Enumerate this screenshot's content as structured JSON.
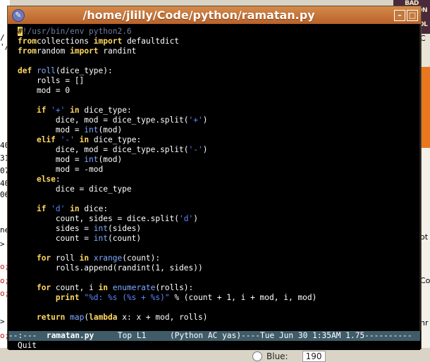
{
  "window": {
    "title": "/home/jlilly/Code/python/ramatan.py"
  },
  "editor": {
    "lines": [
      [
        [
          "cursor",
          "#"
        ],
        [
          "cm",
          "!/usr/bin/env python2.6"
        ]
      ],
      [
        [
          "kw",
          "from"
        ],
        [
          "",
          "collections "
        ],
        [
          "kw",
          "import"
        ],
        [
          "",
          " defaultdict"
        ]
      ],
      [
        [
          "kw",
          "from"
        ],
        [
          "",
          "random "
        ],
        [
          "kw",
          "import"
        ],
        [
          "",
          " randint"
        ]
      ],
      [],
      [
        [
          "kw",
          "def"
        ],
        [
          "",
          " "
        ],
        [
          "fn",
          "roll"
        ],
        [
          "",
          "(dice_type):"
        ]
      ],
      [
        [
          "",
          "    rolls = []"
        ]
      ],
      [
        [
          "",
          "    mod = 0"
        ]
      ],
      [],
      [
        [
          "",
          "    "
        ],
        [
          "kw",
          "if"
        ],
        [
          "",
          " "
        ],
        [
          "str",
          "'+'"
        ],
        [
          "",
          " "
        ],
        [
          "kw",
          "in"
        ],
        [
          "",
          " dice_type:"
        ]
      ],
      [
        [
          "",
          "        dice, mod = dice_type.split("
        ],
        [
          "str",
          "'+'"
        ],
        [
          "",
          ")"
        ]
      ],
      [
        [
          "",
          "        mod = "
        ],
        [
          "bi",
          "int"
        ],
        [
          "",
          "(mod)"
        ]
      ],
      [
        [
          "",
          "    "
        ],
        [
          "kw",
          "elif"
        ],
        [
          "",
          " "
        ],
        [
          "str",
          "'-'"
        ],
        [
          "",
          " "
        ],
        [
          "kw",
          "in"
        ],
        [
          "",
          " dice_type:"
        ]
      ],
      [
        [
          "",
          "        dice, mod = dice_type.split("
        ],
        [
          "str",
          "'-'"
        ],
        [
          "",
          ")"
        ]
      ],
      [
        [
          "",
          "        mod = "
        ],
        [
          "bi",
          "int"
        ],
        [
          "",
          "(mod)"
        ]
      ],
      [
        [
          "",
          "        mod = -mod"
        ]
      ],
      [
        [
          "",
          "    "
        ],
        [
          "kw",
          "else"
        ],
        [
          "",
          ":"
        ]
      ],
      [
        [
          "",
          "        dice = dice_type"
        ]
      ],
      [],
      [
        [
          "",
          "    "
        ],
        [
          "kw",
          "if"
        ],
        [
          "",
          " "
        ],
        [
          "str",
          "'d'"
        ],
        [
          "",
          " "
        ],
        [
          "kw",
          "in"
        ],
        [
          "",
          " dice:"
        ]
      ],
      [
        [
          "",
          "        count, sides = dice.split("
        ],
        [
          "str",
          "'d'"
        ],
        [
          "",
          ")"
        ]
      ],
      [
        [
          "",
          "        sides = "
        ],
        [
          "bi",
          "int"
        ],
        [
          "",
          "(sides)"
        ]
      ],
      [
        [
          "",
          "        count = "
        ],
        [
          "bi",
          "int"
        ],
        [
          "",
          "(count)"
        ]
      ],
      [],
      [
        [
          "",
          "    "
        ],
        [
          "kw",
          "for"
        ],
        [
          "",
          " roll "
        ],
        [
          "kw",
          "in"
        ],
        [
          "",
          " "
        ],
        [
          "bi",
          "xrange"
        ],
        [
          "",
          "(count):"
        ]
      ],
      [
        [
          "",
          "        rolls.append(randint(1, sides))"
        ]
      ],
      [],
      [
        [
          "",
          "    "
        ],
        [
          "kw",
          "for"
        ],
        [
          "",
          " count, i "
        ],
        [
          "kw",
          "in"
        ],
        [
          "",
          " "
        ],
        [
          "bi",
          "enumerate"
        ],
        [
          "",
          "(rolls):"
        ]
      ],
      [
        [
          "",
          "        "
        ],
        [
          "kw",
          "print"
        ],
        [
          "",
          " "
        ],
        [
          "str",
          "\"%d: %s (%s + %s)\""
        ],
        [
          "",
          " % (count + 1, i + mod, i, mod)"
        ]
      ],
      [],
      [
        [
          "",
          "    "
        ],
        [
          "kw",
          "return"
        ],
        [
          "",
          " "
        ],
        [
          "bi",
          "map"
        ],
        [
          "",
          "("
        ],
        [
          "kw",
          "lambda"
        ],
        [
          "",
          " x: x + mod, rolls)"
        ]
      ]
    ]
  },
  "modeline": {
    "prefix": "--:---  ",
    "buffer": "ramatan.py",
    "rest": "     Top L1     (Python AC yas)----Tue Jun 30 1:35AM 1.75----------"
  },
  "minibuffer": {
    "text": "Quit"
  },
  "album_art": {
    "lines": [
      "BAD",
      "RELIGION",
      "MO",
      "CONTROL"
    ]
  },
  "background_left": [
    "/",
    "'/",
    "40",
    "31",
    "07",
    "40",
    "06",
    "ne",
    ">",
    "o;",
    "o;",
    "o;",
    ">",
    "o;"
  ],
  "background_right": [
    "C",
    "ot",
    "Co",
    "nr"
  ],
  "color_picker": {
    "blue_label": "Blue:",
    "blue_value": "190"
  }
}
